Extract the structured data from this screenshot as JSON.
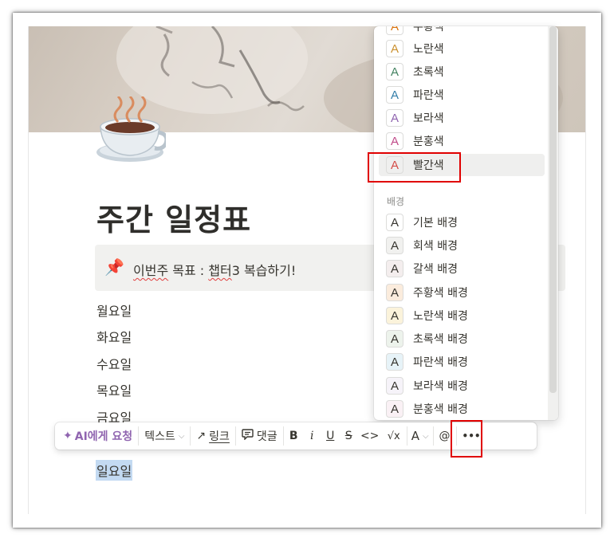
{
  "page": {
    "title": "주간 일정표",
    "callout": {
      "icon": "pushpin-icon",
      "text_parts": [
        "이번주",
        " 목표 : ",
        "챕터",
        "3 복습하기!"
      ]
    },
    "days": [
      "월요일",
      "화요일",
      "수요일",
      "목요일",
      "금요일",
      "일요일"
    ]
  },
  "toolbar": {
    "ai_label": "AI에게 요청",
    "text_label": "텍스트",
    "link_label": "링크",
    "comment_label": "댓글",
    "bold": "B",
    "italic": "i",
    "underline": "U",
    "strike": "S",
    "code": "<>",
    "equation": "√x",
    "color": "A",
    "mention": "@",
    "more": "•••"
  },
  "color_menu": {
    "text_colors": [
      {
        "label": "주황색",
        "color": "#d9730d"
      },
      {
        "label": "노란색",
        "color": "#cb912f"
      },
      {
        "label": "초록색",
        "color": "#448361"
      },
      {
        "label": "파란색",
        "color": "#337ea9"
      },
      {
        "label": "보라색",
        "color": "#9065b0"
      },
      {
        "label": "분홍색",
        "color": "#c14c8a"
      },
      {
        "label": "빨간색",
        "color": "#d44c47"
      }
    ],
    "section_background": "배경",
    "background_colors": [
      {
        "label": "기본 배경",
        "bg": "#ffffff"
      },
      {
        "label": "회색 배경",
        "bg": "#f1f1ef"
      },
      {
        "label": "갈색 배경",
        "bg": "#f4eeee"
      },
      {
        "label": "주황색 배경",
        "bg": "#fbecdd"
      },
      {
        "label": "노란색 배경",
        "bg": "#fbf3db"
      },
      {
        "label": "초록색 배경",
        "bg": "#edf3ec"
      },
      {
        "label": "파란색 배경",
        "bg": "#e7f3f8"
      },
      {
        "label": "보라색 배경",
        "bg": "#f6f3f9"
      },
      {
        "label": "분홍색 배경",
        "bg": "#faf1f5"
      }
    ],
    "swatch_letter": "A"
  },
  "colors": {
    "highlight_box": "#e00000",
    "selection": "#c3daf2",
    "ai_purple": "#9065b0"
  }
}
